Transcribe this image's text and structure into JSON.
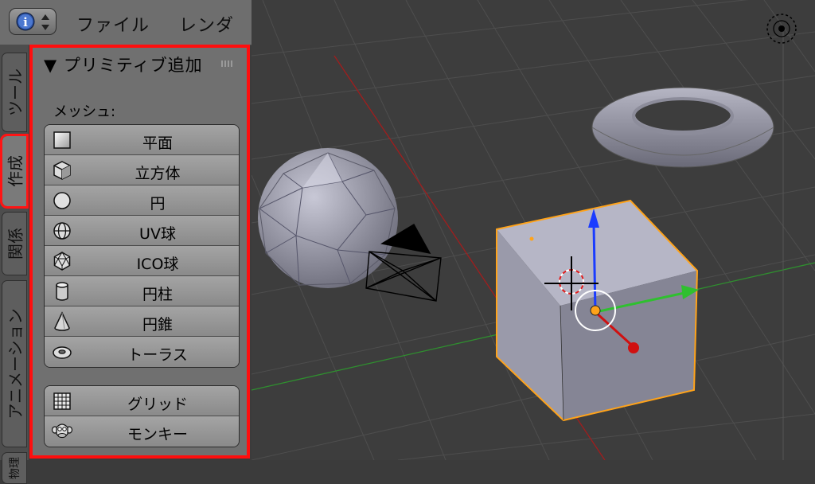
{
  "header": {
    "menus": [
      "ファイル",
      "レンダー"
    ],
    "editor_icon": "info-icon"
  },
  "tabs": [
    "ツール",
    "作成",
    "関係",
    "アニメーション",
    "物理"
  ],
  "panel": {
    "title": "▼ プリミティブ追加",
    "mesh_label": "メッシュ:",
    "mesh_buttons": [
      {
        "label": "平面",
        "icon": "plane-icon"
      },
      {
        "label": "立方体",
        "icon": "cube-icon"
      },
      {
        "label": "円",
        "icon": "circle-icon"
      },
      {
        "label": "UV球",
        "icon": "uv-sphere-icon"
      },
      {
        "label": "ICO球",
        "icon": "ico-sphere-icon"
      },
      {
        "label": "円柱",
        "icon": "cylinder-icon"
      },
      {
        "label": "円錐",
        "icon": "cone-icon"
      },
      {
        "label": "トーラス",
        "icon": "torus-icon"
      }
    ],
    "extra_buttons": [
      {
        "label": "グリッド",
        "icon": "grid-icon"
      },
      {
        "label": "モンキー",
        "icon": "monkey-icon"
      }
    ]
  },
  "colors": {
    "highlight": "#ff1414",
    "selected_outline": "#ffa31a",
    "axis_x": "#d01010",
    "axis_y": "#2fc02f",
    "axis_z": "#1a3cff"
  }
}
